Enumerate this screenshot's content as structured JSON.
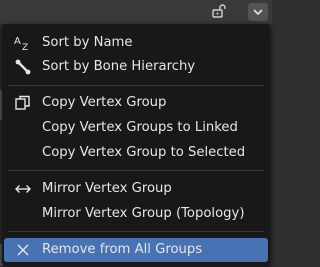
{
  "header": {
    "lock_icon": "lock-open-icon",
    "dropdown_icon": "chevron-down-icon"
  },
  "menu": {
    "items": [
      {
        "label": "Sort by Name",
        "icon": "sort-alpha-icon"
      },
      {
        "label": "Sort by Bone Hierarchy",
        "icon": "bone-icon"
      },
      {
        "label": "Copy Vertex Group",
        "icon": "duplicate-icon"
      },
      {
        "label": "Copy Vertex Groups to Linked",
        "icon": ""
      },
      {
        "label": "Copy Vertex Group to Selected",
        "icon": ""
      },
      {
        "label": "Mirror Vertex Group",
        "icon": "mirror-arrows-icon"
      },
      {
        "label": "Mirror Vertex Group (Topology)",
        "icon": ""
      },
      {
        "label": "Remove from All Groups",
        "icon": "x-icon"
      }
    ]
  },
  "colors": {
    "menu_bg": "#181818",
    "highlight": "#4772b3",
    "text": "#e6e6e6"
  }
}
